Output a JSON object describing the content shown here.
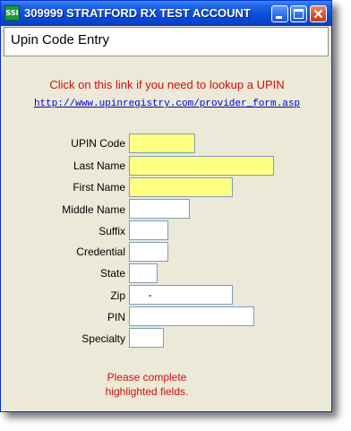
{
  "window": {
    "app_icon_text": "SSI",
    "title": "309999 STRATFORD RX TEST ACCOUNT",
    "buttons": [
      "minimize",
      "maximize",
      "close"
    ],
    "colors": {
      "titlebar": "#0a4ad6",
      "body": "#ece9d8",
      "required_field": "#ffff80",
      "alert_text": "#cc1111",
      "link_text": "#0000cc"
    }
  },
  "header": {
    "title": "Upin Code Entry"
  },
  "lookup": {
    "prompt": "Click on this link if you need to lookup a UPIN",
    "url": "http://www.upinregistry.com/provider_form.asp"
  },
  "form": {
    "fields": [
      {
        "label": "UPIN Code",
        "value": "",
        "required": true
      },
      {
        "label": "Last Name",
        "value": "",
        "required": true
      },
      {
        "label": "First Name",
        "value": "",
        "required": true
      },
      {
        "label": "Middle Name",
        "value": "",
        "required": false
      },
      {
        "label": "Suffix",
        "value": "",
        "required": false
      },
      {
        "label": "Credential",
        "value": "",
        "required": false
      },
      {
        "label": "State",
        "value": "",
        "required": false
      },
      {
        "label": "Zip",
        "value": "     -",
        "required": false
      },
      {
        "label": "PIN",
        "value": "",
        "required": false
      },
      {
        "label": "Specialty",
        "value": "",
        "required": false
      }
    ]
  },
  "note": {
    "line1": "Please complete",
    "line2": "highlighted fields."
  }
}
